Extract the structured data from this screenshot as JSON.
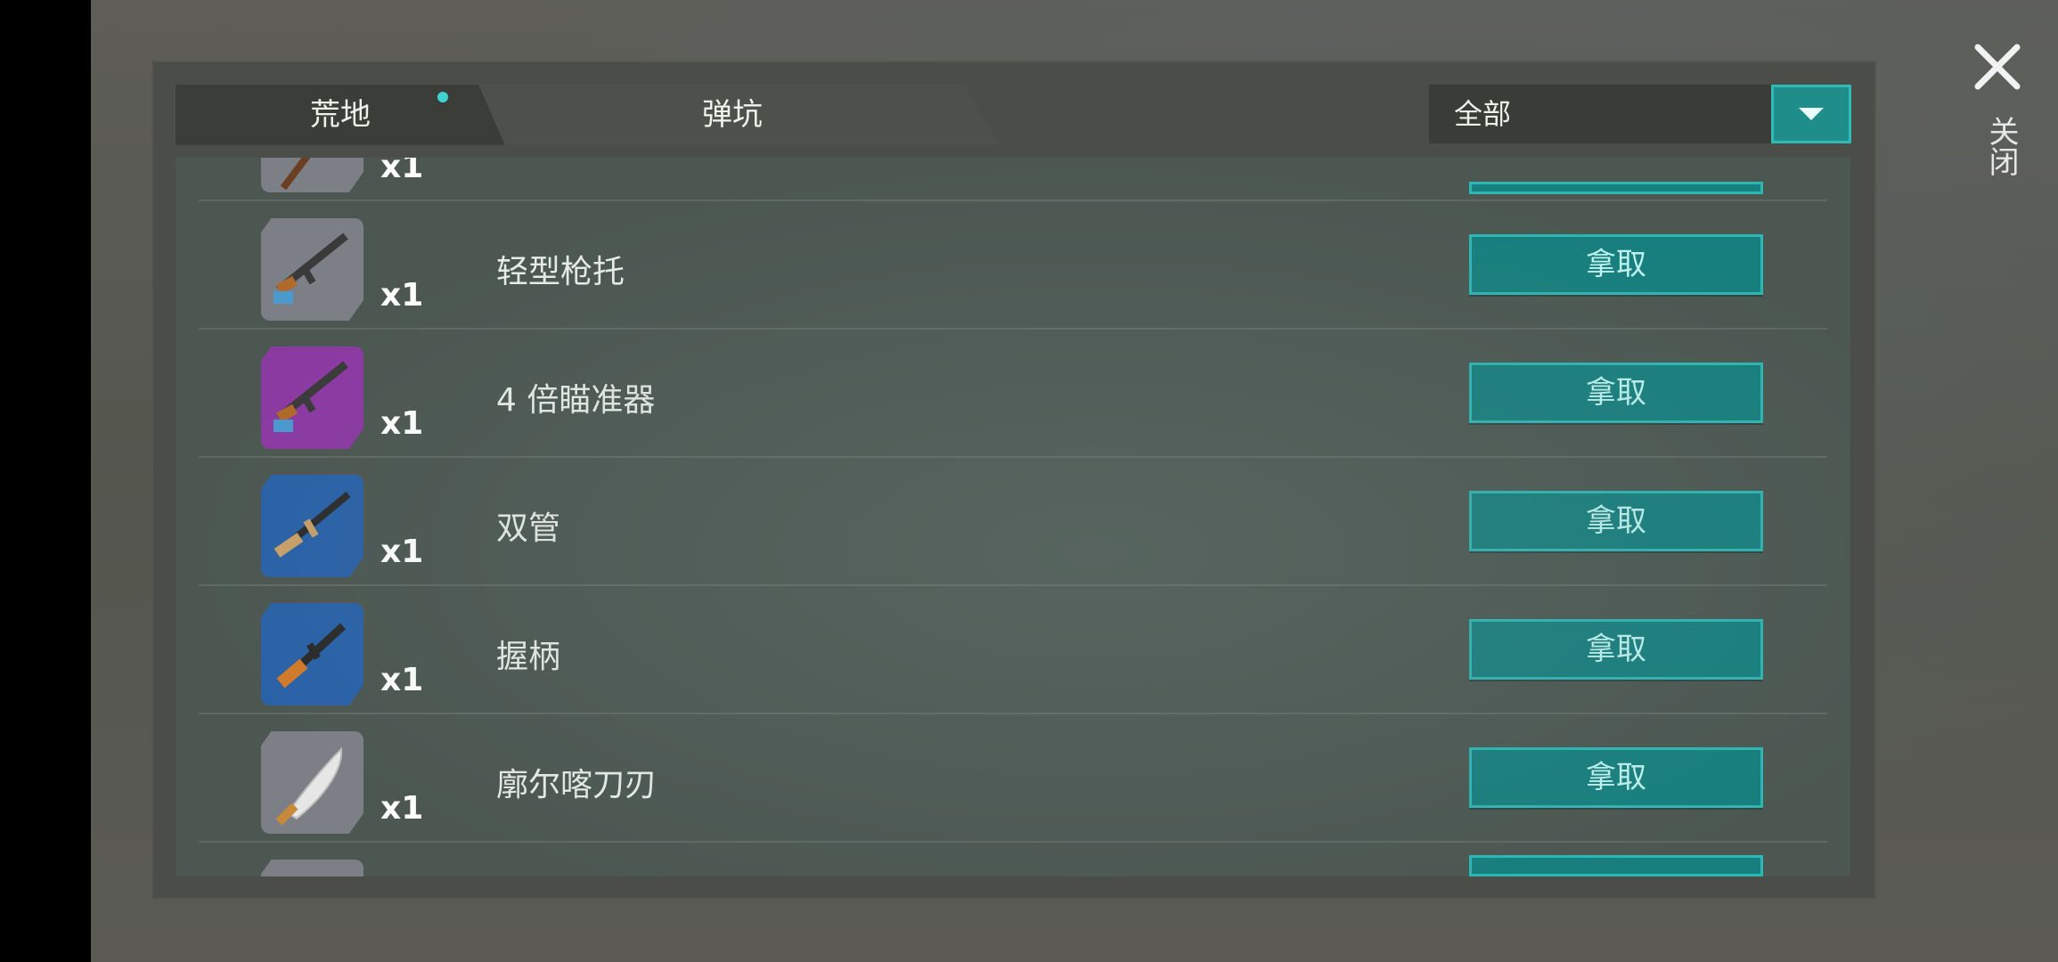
{
  "tabs": [
    {
      "label": "荒地",
      "active": true,
      "has_dot": true
    },
    {
      "label": "弹坑",
      "active": false
    }
  ],
  "filter": {
    "selected": "全部"
  },
  "close": {
    "label": "关闭"
  },
  "items": [
    {
      "qty": "x1",
      "name": "",
      "icon": "blueprint-gray-partial-icon"
    },
    {
      "qty": "x1",
      "name": "轻型枪托",
      "button": "拿取",
      "icon": "blueprint-gray-rifle-icon"
    },
    {
      "qty": "x1",
      "name": "4 倍瞄准器",
      "button": "拿取",
      "icon": "blueprint-purple-rifle-icon"
    },
    {
      "qty": "x1",
      "name": "双管",
      "button": "拿取",
      "icon": "blueprint-blue-rifle-icon"
    },
    {
      "qty": "x1",
      "name": "握柄",
      "button": "拿取",
      "icon": "blueprint-blue-smg-icon"
    },
    {
      "qty": "x1",
      "name": "廓尔喀刀刃",
      "button": "拿取",
      "icon": "blueprint-gray-blade-icon"
    }
  ],
  "colors": {
    "accent": "#177f7e",
    "accent_border": "#2bb7b4",
    "button_text": "#bff2ef"
  }
}
